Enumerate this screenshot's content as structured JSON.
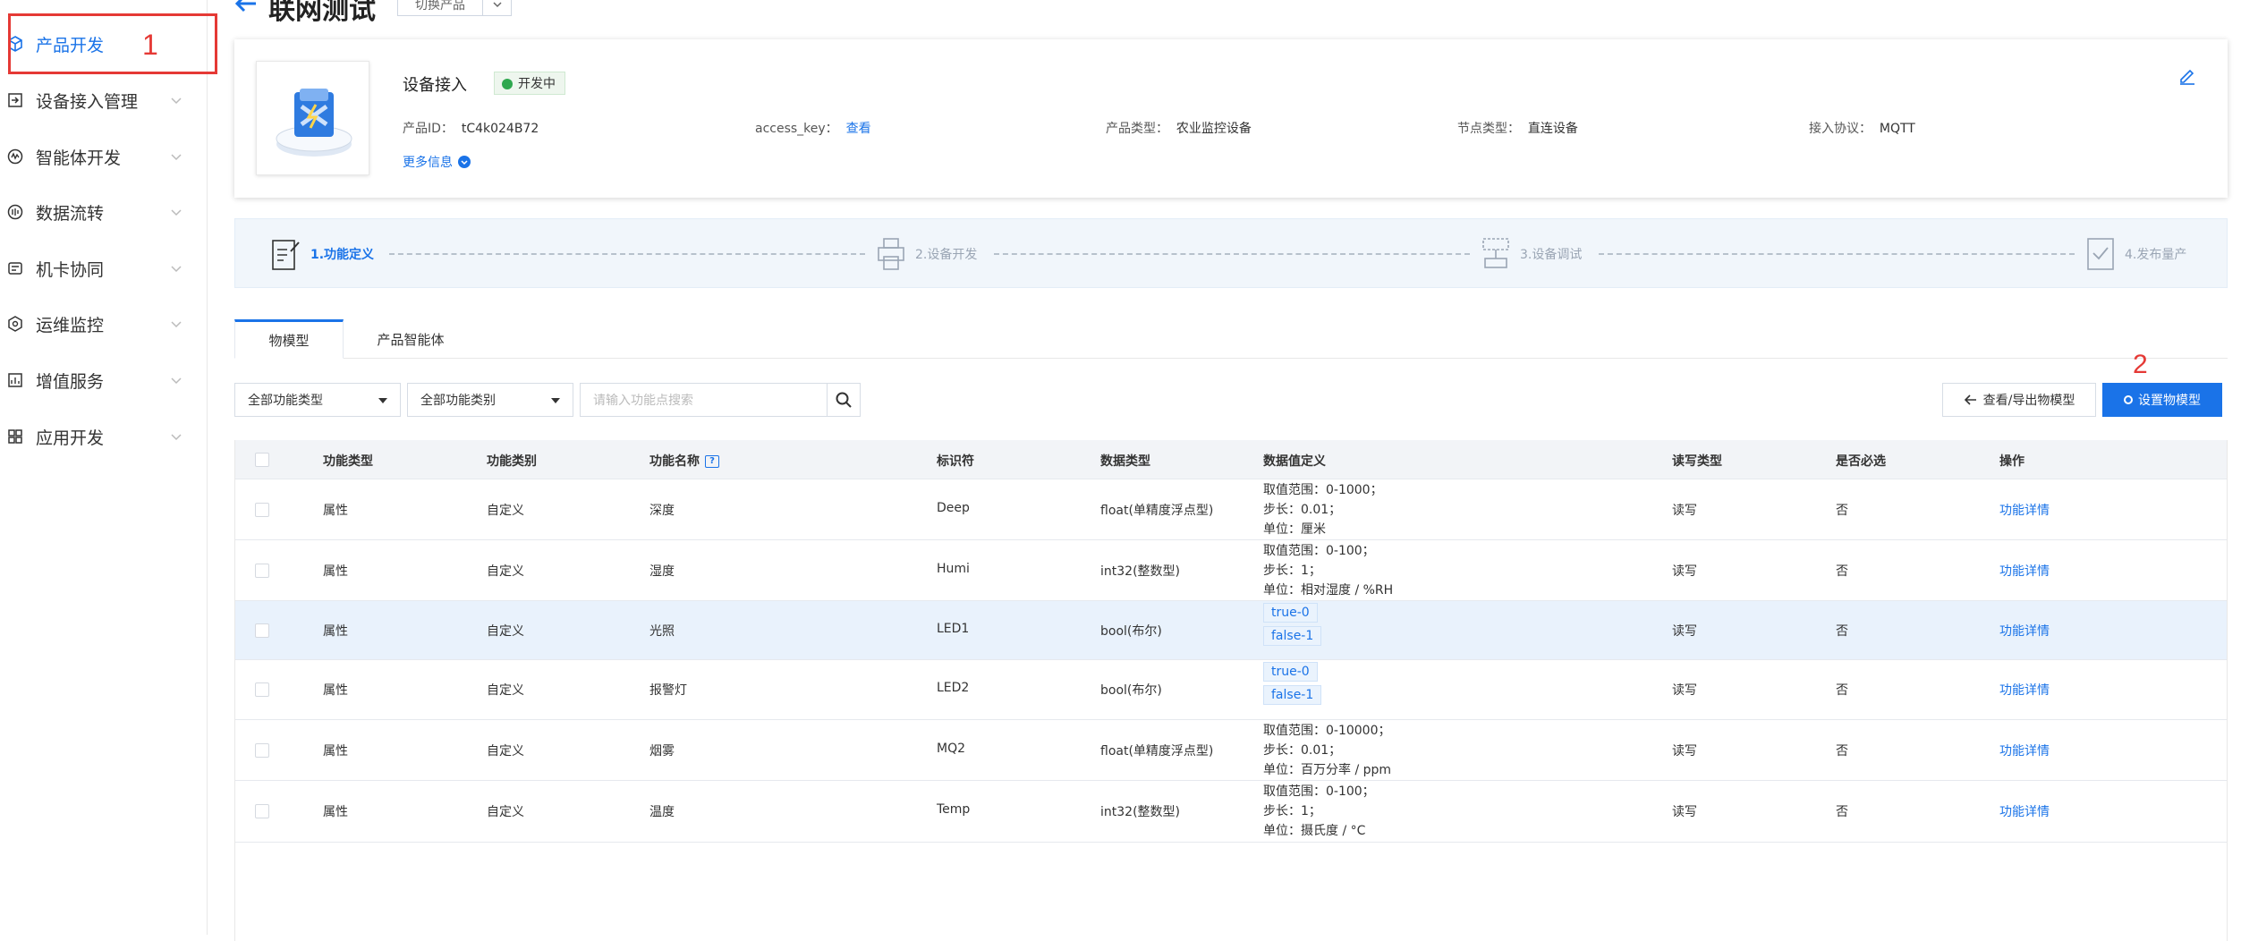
{
  "sidebar": {
    "items": [
      {
        "label": "产品开发",
        "icon": "cube-icon",
        "active": true
      },
      {
        "label": "设备接入管理",
        "icon": "import-icon"
      },
      {
        "label": "智能体开发",
        "icon": "ai-icon"
      },
      {
        "label": "数据流转",
        "icon": "data-flow-icon"
      },
      {
        "label": "机卡协同",
        "icon": "sim-card-icon"
      },
      {
        "label": "运维监控",
        "icon": "monitor-icon"
      },
      {
        "label": "增值服务",
        "icon": "chart-icon"
      },
      {
        "label": "应用开发",
        "icon": "apps-icon"
      }
    ]
  },
  "annotations": {
    "n1": "1",
    "n2": "2"
  },
  "header": {
    "title": "联网测试",
    "switch_label": "切换产品"
  },
  "product": {
    "name": "设备接入",
    "status": "开发中",
    "id_label": "产品ID：",
    "id_value": "tC4k024B72",
    "access_key_label": "access_key：",
    "access_key_link": "查看",
    "type_label": "产品类型：",
    "type_value": "农业监控设备",
    "node_label": "节点类型：",
    "node_value": "直连设备",
    "protocol_label": "接入协议：",
    "protocol_value": "MQTT",
    "more_info": "更多信息"
  },
  "steps": [
    {
      "label": "1.功能定义",
      "active": true
    },
    {
      "label": "2.设备开发",
      "active": false
    },
    {
      "label": "3.设备调试",
      "active": false
    },
    {
      "label": "4.发布量产",
      "active": false
    }
  ],
  "tabs": [
    {
      "label": "物模型",
      "active": true
    },
    {
      "label": "产品智能体",
      "active": false
    }
  ],
  "filters": {
    "func_type": "全部功能类型",
    "func_category": "全部功能类别",
    "search_placeholder": "请输入功能点搜索"
  },
  "actions": {
    "export": "查看/导出物模型",
    "setting": "设置物模型"
  },
  "table": {
    "headers": [
      "功能类型",
      "功能类别",
      "功能名称",
      "标识符",
      "数据类型",
      "数据值定义",
      "读写类型",
      "是否必选",
      "操作"
    ],
    "rows": [
      {
        "type": "属性",
        "category": "自定义",
        "name": "深度",
        "id": "Deep",
        "dtype": "float(单精度浮点型)",
        "def": [
          "取值范围：0-1000；",
          "步长：0.01；",
          "单位：厘米"
        ],
        "rw": "读写",
        "required": "否",
        "op": "功能详情"
      },
      {
        "type": "属性",
        "category": "自定义",
        "name": "湿度",
        "id": "Humi",
        "dtype": "int32(整数型)",
        "def": [
          "取值范围：0-100；",
          "步长：1；",
          "单位：相对湿度 / %RH"
        ],
        "rw": "读写",
        "required": "否",
        "op": "功能详情"
      },
      {
        "type": "属性",
        "category": "自定义",
        "name": "光照",
        "id": "LED1",
        "dtype": "bool(布尔)",
        "tags": [
          "true-0",
          "false-1"
        ],
        "rw": "读写",
        "required": "否",
        "op": "功能详情"
      },
      {
        "type": "属性",
        "category": "自定义",
        "name": "报警灯",
        "id": "LED2",
        "dtype": "bool(布尔)",
        "tags": [
          "true-0",
          "false-1"
        ],
        "rw": "读写",
        "required": "否",
        "op": "功能详情"
      },
      {
        "type": "属性",
        "category": "自定义",
        "name": "烟雾",
        "id": "MQ2",
        "dtype": "float(单精度浮点型)",
        "def": [
          "取值范围：0-10000；",
          "步长：0.01；",
          "单位：百万分率 / ppm"
        ],
        "rw": "读写",
        "required": "否",
        "op": "功能详情"
      },
      {
        "type": "属性",
        "category": "自定义",
        "name": "温度",
        "id": "Temp",
        "dtype": "int32(整数型)",
        "def": [
          "取值范围：0-100；",
          "步长：1；",
          "单位：摄氏度 / °C"
        ],
        "rw": "读写",
        "required": "否",
        "op": "功能详情"
      }
    ]
  },
  "colors": {
    "accent": "#1a73e8",
    "highlight": "#e53935",
    "status_green": "#2fa84f"
  }
}
